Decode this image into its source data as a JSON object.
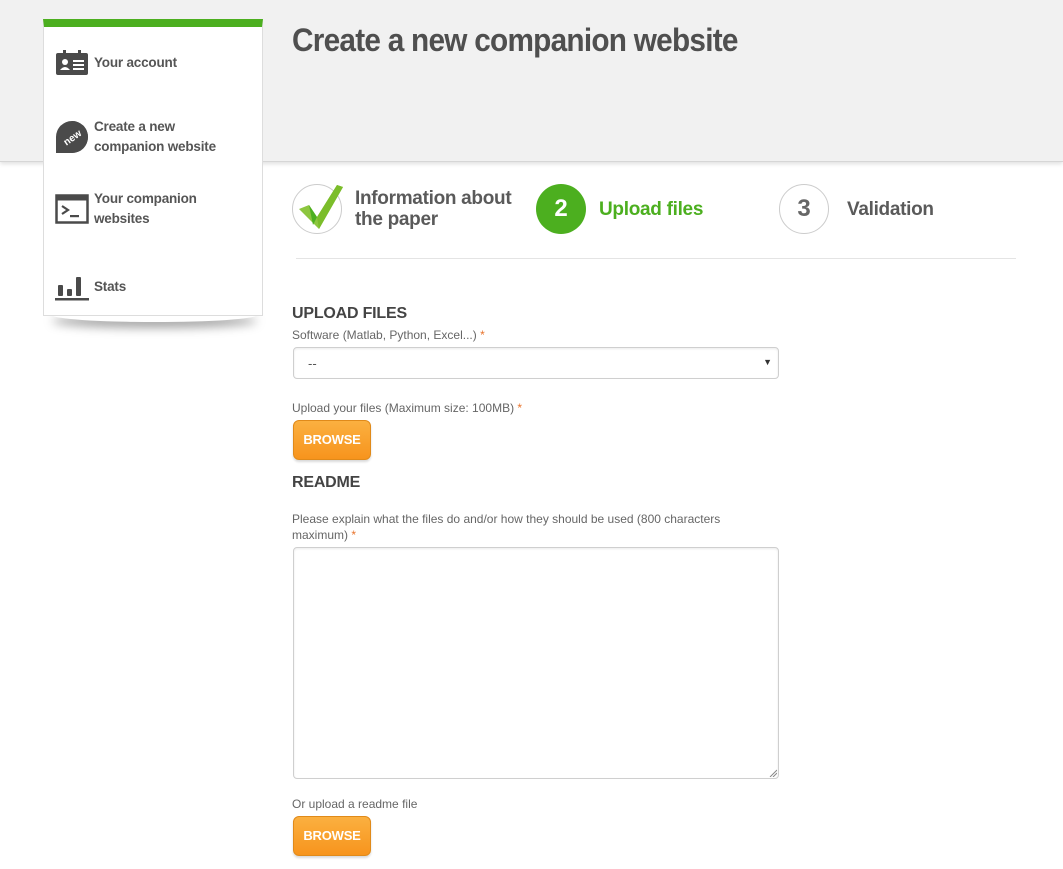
{
  "header": {
    "title": "Create a new companion website"
  },
  "sidebar": {
    "items": [
      {
        "label": "Your account",
        "icon": "id-card-icon"
      },
      {
        "label": "Create a new companion website",
        "icon": "new-badge-icon"
      },
      {
        "label": "Your companion websites",
        "icon": "terminal-icon"
      },
      {
        "label": "Stats",
        "icon": "bar-chart-icon"
      }
    ],
    "accent": "#4caf1f"
  },
  "steps": [
    {
      "number": "",
      "label": "Information about the paper",
      "status": "completed",
      "icon": "checkmark-icon"
    },
    {
      "number": "2",
      "label": "Upload files",
      "status": "active"
    },
    {
      "number": "3",
      "label": "Validation",
      "status": "pending"
    }
  ],
  "form": {
    "upload_heading": "UPLOAD FILES",
    "software_label": "Software (Matlab, Python, Excel...)",
    "software_value": "--",
    "upload_label": "Upload your files (Maximum size: 100MB)",
    "browse_label": "BROWSE",
    "readme_heading": "README",
    "readme_label": "Please explain what the files do and/or how they should be used (800 characters maximum)",
    "readme_value": "",
    "readme_file_label": "Or upload a readme file",
    "readme_browse_label": "BROWSE",
    "required_mark": "*"
  },
  "colors": {
    "active_green": "#4caf1f",
    "button_orange": "#f7941d",
    "required": "#e8732b"
  }
}
